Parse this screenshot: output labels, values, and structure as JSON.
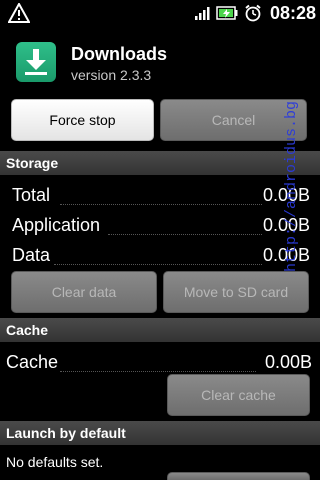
{
  "status_bar": {
    "time": "08:28",
    "icons": [
      "warning-icon",
      "signal-icon",
      "battery-charging-icon",
      "alarm-clock-icon"
    ]
  },
  "app": {
    "name": "Downloads",
    "version": "version 2.3.3",
    "icon": "download-arrow-icon",
    "icon_color": "#2fbf8a"
  },
  "buttons": {
    "force_stop": "Force stop",
    "cancel": "Cancel",
    "clear_data": "Clear data",
    "move_to_sd": "Move to SD card",
    "clear_cache": "Clear cache"
  },
  "storage": {
    "header": "Storage",
    "rows": [
      {
        "label": "Total",
        "value": "0.00B"
      },
      {
        "label": "Application",
        "value": "0.00B"
      },
      {
        "label": "Data",
        "value": "0.00B"
      }
    ]
  },
  "cache": {
    "header": "Cache",
    "row": {
      "label": "Cache",
      "value": "0.00B"
    }
  },
  "launch": {
    "header": "Launch by default",
    "text": "No defaults set."
  },
  "watermark": "http://androidus.bg",
  "colors": {
    "background": "#000000",
    "section_header": "#3c3c3c",
    "watermark": "#2b3bdc"
  }
}
